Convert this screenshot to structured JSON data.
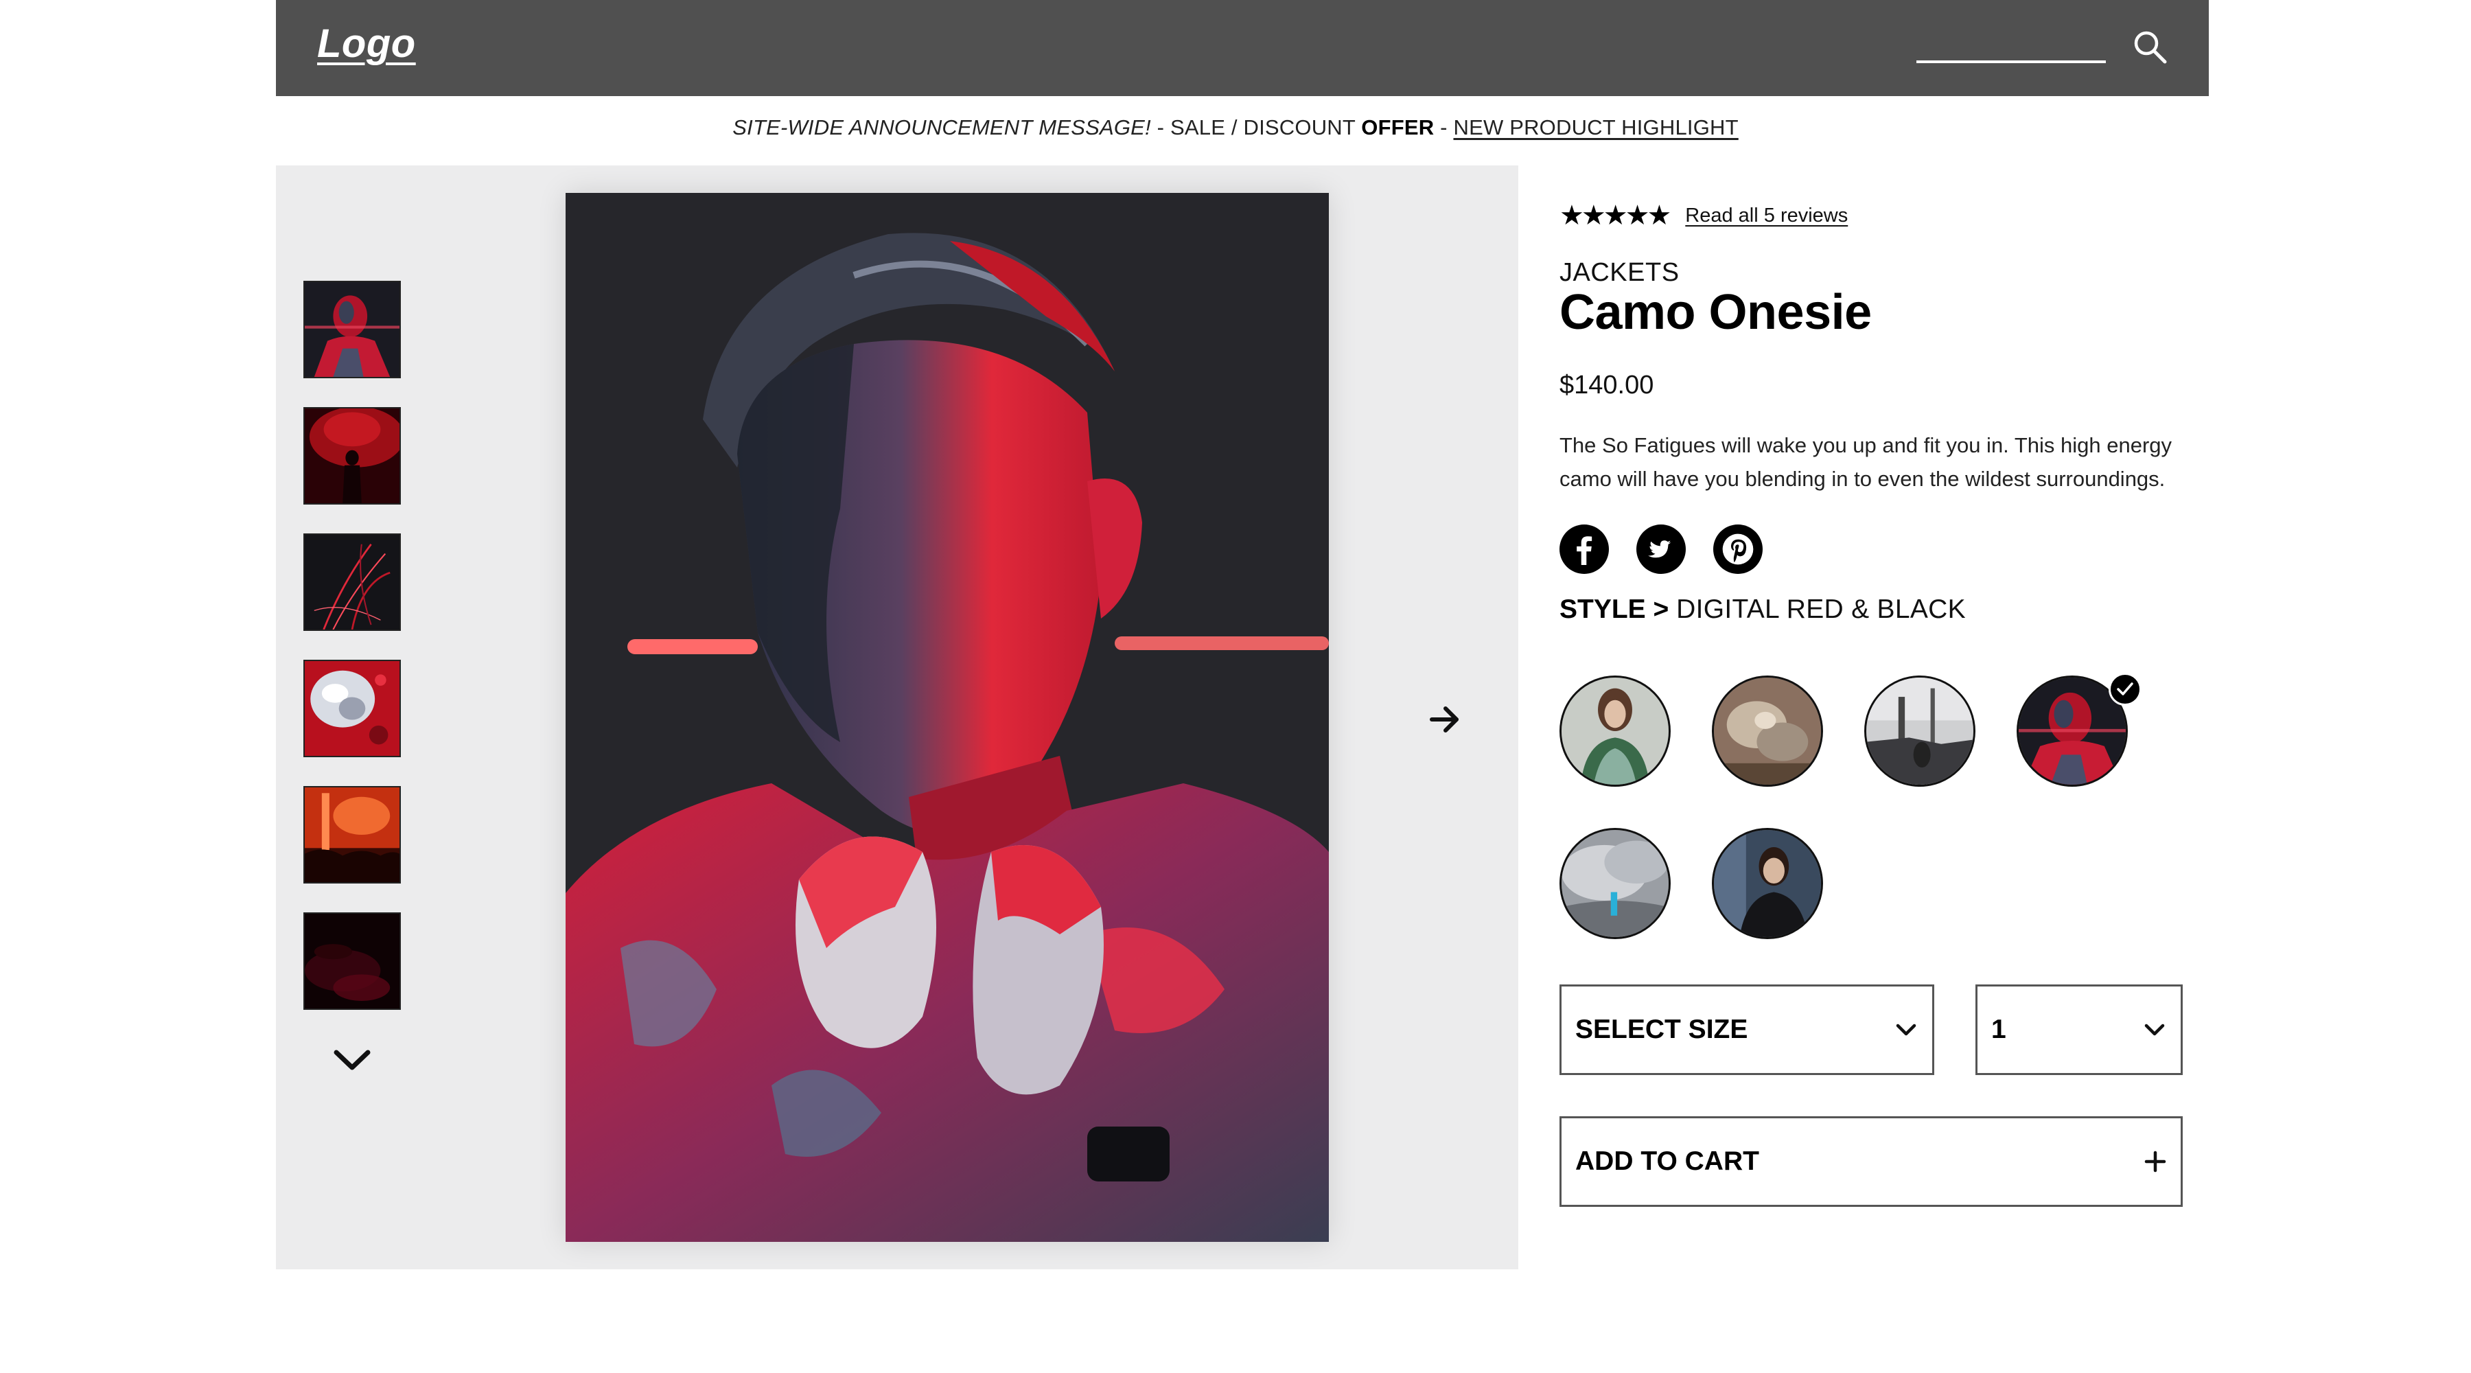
{
  "header": {
    "logo": "Logo",
    "search": {
      "value": "",
      "placeholder": ""
    },
    "icon": "search-icon",
    "background": "#505050"
  },
  "announcement": {
    "message": "SITE-WIDE ANNOUNCEMENT MESSAGE!",
    "sep1": " - SALE / DISCOUNT ",
    "offer": "OFFER",
    "sep2": " - ",
    "link": "NEW PRODUCT HIGHLIGHT"
  },
  "gallery": {
    "thumbnails": [
      "thumb-1",
      "thumb-2",
      "thumb-3",
      "thumb-4",
      "thumb-5",
      "thumb-6"
    ],
    "thumbs_down_icon": "chevron-down-icon",
    "next_icon": "arrow-right-icon",
    "background": "#ececed"
  },
  "product": {
    "rating": {
      "stars": "★★★★★",
      "value": 5,
      "max": 5
    },
    "reviews_link": "Read all 5 reviews",
    "category": "JACKETS",
    "title": "Camo Onesie",
    "price": "$140.00",
    "description": "The So Fatigues will wake you up and fit you in. This high energy camo will have you blending in to even the wildest surroundings.",
    "social": [
      "facebook-icon",
      "twitter-icon",
      "pinterest-icon"
    ],
    "style_label": "STYLE > ",
    "style_value": "DIGITAL RED & BLACK",
    "styles": [
      {
        "name": "style-1",
        "selected": false
      },
      {
        "name": "style-2",
        "selected": false
      },
      {
        "name": "style-3",
        "selected": false
      },
      {
        "name": "style-4",
        "selected": true
      },
      {
        "name": "style-5",
        "selected": false
      },
      {
        "name": "style-6",
        "selected": false
      }
    ],
    "size_select": {
      "value": "SELECT SIZE",
      "icon": "chevron-down-icon"
    },
    "qty_select": {
      "value": "1",
      "icon": "chevron-down-icon"
    },
    "add_to_cart": {
      "label": "ADD TO CART",
      "icon": "plus-icon"
    }
  }
}
